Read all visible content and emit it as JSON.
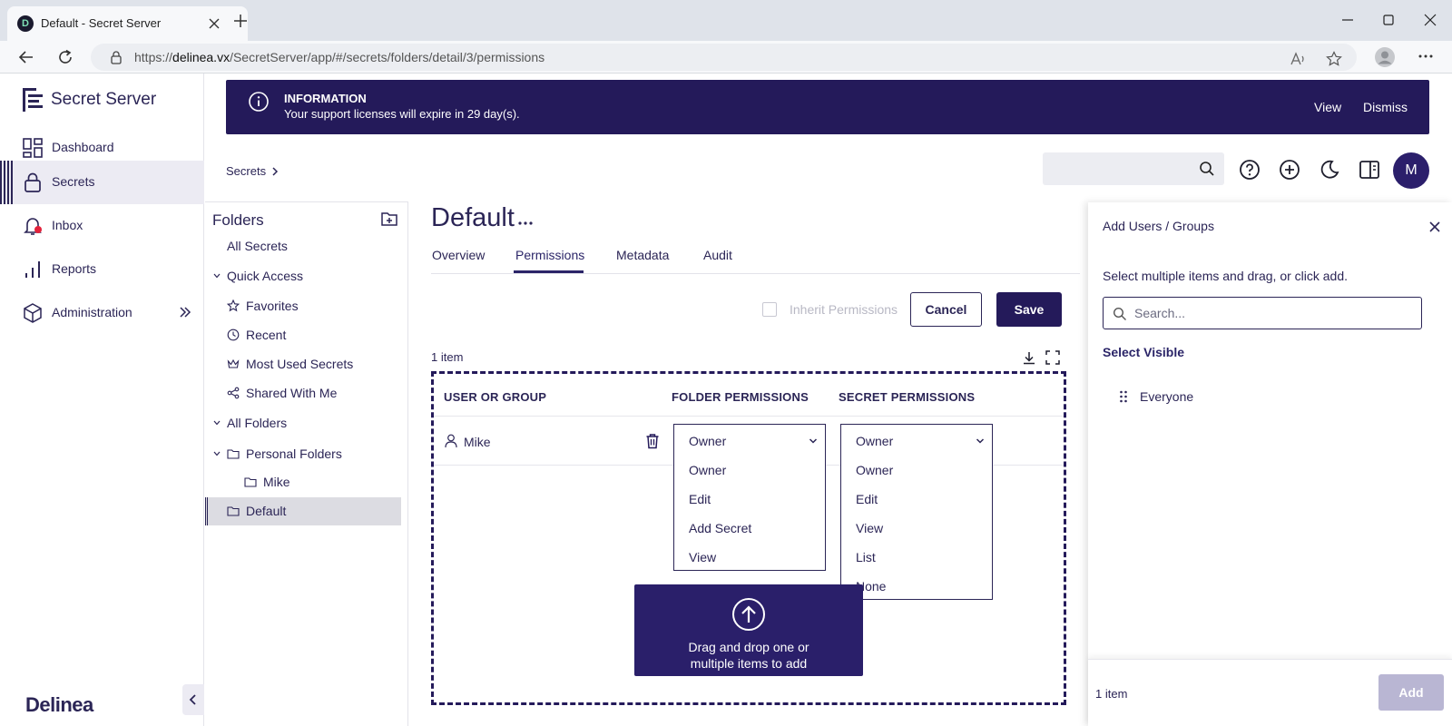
{
  "browser": {
    "tab_title": "Default - Secret Server",
    "url_prefix": "https://",
    "url_host": "delinea.vx",
    "url_path": "/SecretServer/app/#/secrets/folders/detail/3/permissions"
  },
  "brand": {
    "name": "Secret Server",
    "footer_logo": "Delinea"
  },
  "nav": {
    "items": [
      {
        "label": "Dashboard",
        "icon": "dashboard-icon"
      },
      {
        "label": "Secrets",
        "icon": "lock-icon",
        "active": true
      },
      {
        "label": "Inbox",
        "icon": "bell-icon"
      },
      {
        "label": "Reports",
        "icon": "bar-chart-icon"
      },
      {
        "label": "Administration",
        "icon": "cube-icon"
      }
    ]
  },
  "banner": {
    "title": "INFORMATION",
    "message": "Your support licenses will expire in 29 day(s).",
    "view_label": "View",
    "dismiss_label": "Dismiss"
  },
  "breadcrumb": {
    "label": "Secrets"
  },
  "avatar_initial": "M",
  "folders": {
    "title": "Folders",
    "rows": {
      "all_secrets": "All Secrets",
      "quick_access": "Quick Access",
      "favorites": "Favorites",
      "recent": "Recent",
      "most_used": "Most Used Secrets",
      "shared": "Shared With Me",
      "all_folders": "All Folders",
      "personal": "Personal Folders",
      "mike": "Mike",
      "default": "Default"
    }
  },
  "page": {
    "title": "Default",
    "tabs": {
      "overview": "Overview",
      "permissions": "Permissions",
      "metadata": "Metadata",
      "audit": "Audit"
    },
    "inherit_label": "Inherit Permissions",
    "cancel_label": "Cancel",
    "save_label": "Save",
    "item_count": "1 item"
  },
  "table": {
    "headers": {
      "user": "USER OR GROUP",
      "folder": "FOLDER PERMISSIONS",
      "secret": "SECRET PERMISSIONS"
    },
    "row": {
      "user": "Mike",
      "folder_permission": "Owner",
      "secret_permission": "Owner"
    },
    "folder_options": [
      "Owner",
      "Edit",
      "Add Secret",
      "View"
    ],
    "secret_options": [
      "Owner",
      "Edit",
      "View",
      "List",
      "None"
    ]
  },
  "dropzone": {
    "line1": "Drag and drop one or",
    "line2": "multiple items to add"
  },
  "add_panel": {
    "title": "Add Users / Groups",
    "help": "Select multiple items and drag, or click add.",
    "search_placeholder": "Search...",
    "select_visible": "Select Visible",
    "items": [
      "Everyone"
    ],
    "count": "1 item",
    "add_label": "Add"
  }
}
